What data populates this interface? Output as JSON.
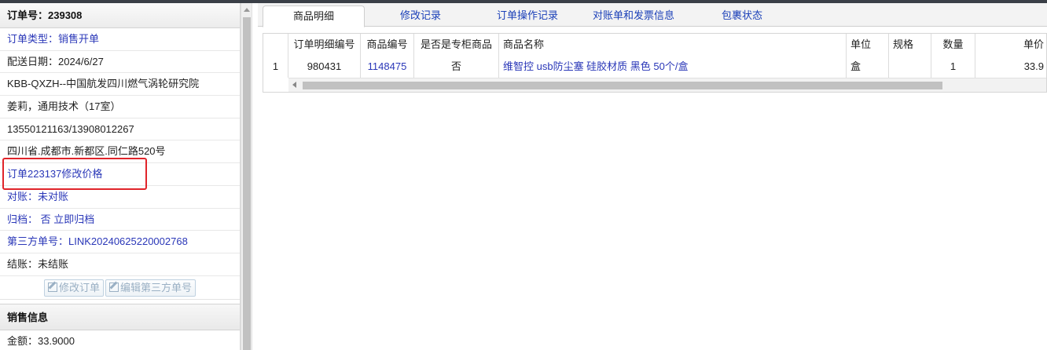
{
  "order": {
    "header_label": "订单号：",
    "number": "239308"
  },
  "info": [
    {
      "text": "订单类型：销售开单",
      "style": "link"
    },
    {
      "text": "配送日期：2024/6/27",
      "style": "dark"
    },
    {
      "text": "KBB-QXZH--中国航发四川燃气涡轮研究院",
      "style": "dark"
    },
    {
      "text": "姜莉，通用技术（17室）",
      "style": "dark"
    },
    {
      "text": "13550121163/13908012267",
      "style": "dark"
    },
    {
      "text": "四川省.成都市.新都区.同仁路520号",
      "style": "dark"
    },
    {
      "text": "订单223137修改价格",
      "style": "link"
    },
    {
      "text": "对账：未对账",
      "style": "link"
    },
    {
      "text": "归档： 否 立即归档",
      "style": "link"
    },
    {
      "text": "第三方单号：LINK20240625220002768",
      "style": "link"
    },
    {
      "text": "结账：未结账",
      "style": "dark"
    }
  ],
  "buttons": {
    "edit_order": "修改订单",
    "edit_third_party": "编辑第三方单号"
  },
  "sales": {
    "title": "销售信息",
    "amount": "金额：33.9000"
  },
  "tabs": [
    "商品明细",
    "修改记录",
    "订单操作记录",
    "对账单和发票信息",
    "包裹状态"
  ],
  "table": {
    "columns": [
      "",
      "订单明细编号",
      "商品编号",
      "是否是专柜商品",
      "商品名称",
      "单位",
      "规格",
      "数量",
      "单价"
    ],
    "rows": [
      [
        "1",
        "980431",
        "1148475",
        "否",
        "维智控 usb防尘塞 硅胶材质 黑色 50个/盒",
        "盒",
        "",
        "1",
        "33.9"
      ]
    ]
  },
  "colors": {
    "link": "#2a37b8",
    "highlight_border": "#e0242a",
    "tab_text": "#1a3fb8"
  }
}
